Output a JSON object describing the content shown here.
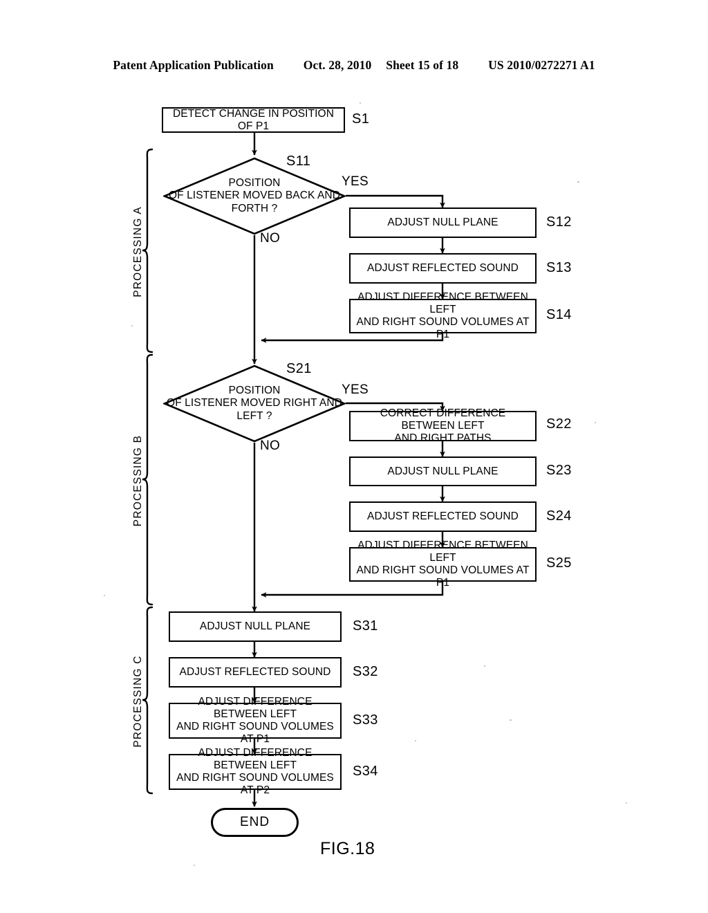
{
  "header": {
    "publication": "Patent Application Publication",
    "date": "Oct. 28, 2010",
    "sheet": "Sheet 15 of 18",
    "patent_number": "US 2010/0272271 A1"
  },
  "figure": {
    "caption": "FIG.18"
  },
  "groups": [
    {
      "id": "A",
      "label": "PROCESSING A"
    },
    {
      "id": "B",
      "label": "PROCESSING B"
    },
    {
      "id": "C",
      "label": "PROCESSING C"
    }
  ],
  "edge_labels": {
    "yes_1": "YES",
    "no_1": "NO",
    "yes_2": "YES",
    "no_2": "NO"
  },
  "nodes": {
    "s1": {
      "step": "S1",
      "text": "DETECT CHANGE IN POSITION OF P1"
    },
    "s11": {
      "step": "S11",
      "line1": "POSITION",
      "line2": "OF LISTENER MOVED BACK AND",
      "line3": "FORTH ?"
    },
    "s12": {
      "step": "S12",
      "text": "ADJUST NULL PLANE"
    },
    "s13": {
      "step": "S13",
      "text": "ADJUST REFLECTED SOUND"
    },
    "s14": {
      "step": "S14",
      "line1": "ADJUST DIFFERENCE BETWEEN LEFT",
      "line2": "AND RIGHT SOUND VOLUMES AT P1"
    },
    "s21": {
      "step": "S21",
      "line1": "POSITION",
      "line2": "OF LISTENER MOVED RIGHT AND",
      "line3": "LEFT ?"
    },
    "s22": {
      "step": "S22",
      "line1": "CORRECT DIFFERENCE BETWEEN LEFT",
      "line2": "AND RIGHT PATHS"
    },
    "s23": {
      "step": "S23",
      "text": "ADJUST NULL PLANE"
    },
    "s24": {
      "step": "S24",
      "text": "ADJUST REFLECTED SOUND"
    },
    "s25": {
      "step": "S25",
      "line1": "ADJUST DIFFERENCE BETWEEN LEFT",
      "line2": "AND RIGHT SOUND VOLUMES AT P1"
    },
    "s31": {
      "step": "S31",
      "text": "ADJUST NULL PLANE"
    },
    "s32": {
      "step": "S32",
      "text": "ADJUST REFLECTED SOUND"
    },
    "s33": {
      "step": "S33",
      "line1": "ADJUST DIFFERENCE BETWEEN LEFT",
      "line2": "AND RIGHT SOUND VOLUMES AT P1"
    },
    "s34": {
      "step": "S34",
      "line1": "ADJUST DIFFERENCE BETWEEN LEFT",
      "line2": "AND RIGHT SOUND VOLUMES AT P2"
    },
    "end": {
      "text": "END"
    }
  },
  "colors": {
    "ink": "#000000",
    "paper": "#ffffff"
  }
}
